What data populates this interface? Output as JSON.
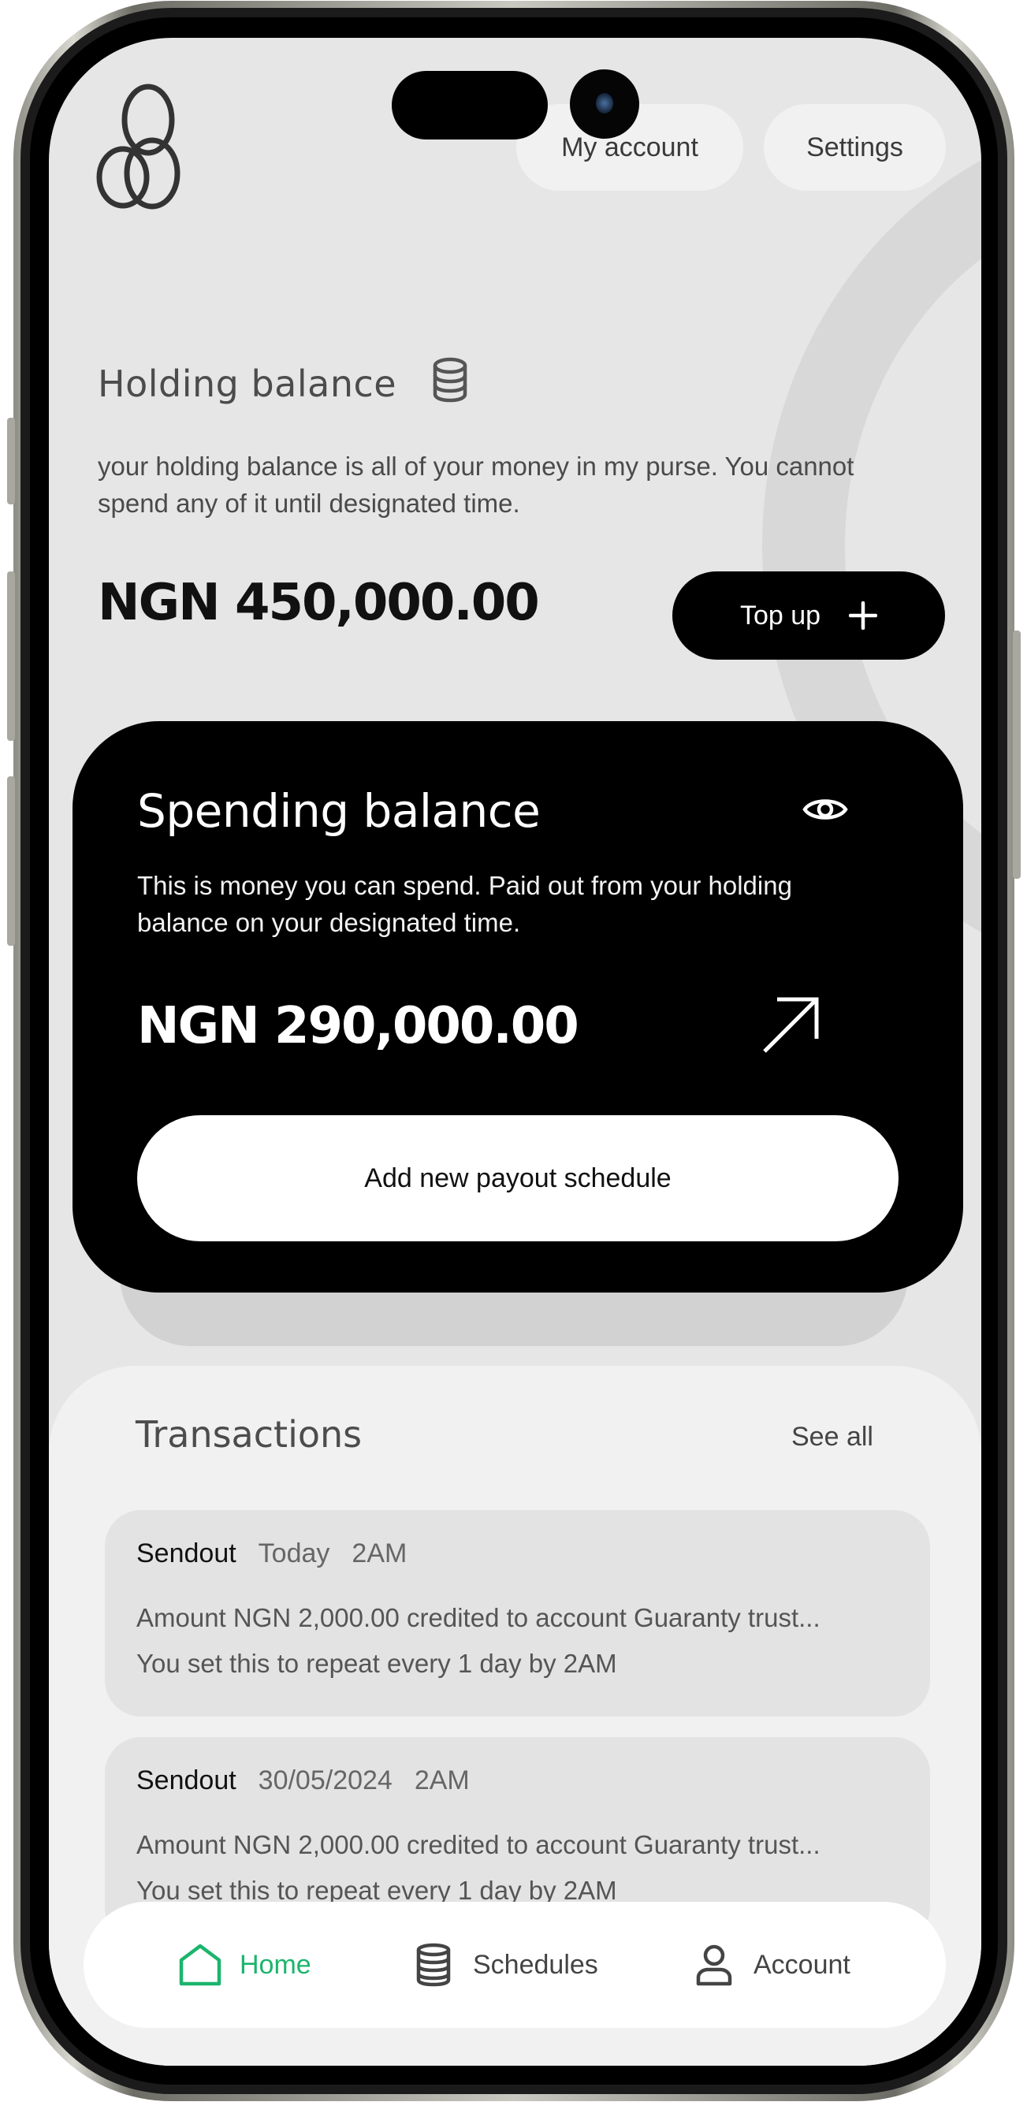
{
  "header": {
    "my_account_label": "My account",
    "settings_label": "Settings"
  },
  "holding": {
    "title": "Holding balance",
    "description": "your holding balance is all of your money in my purse. You cannot spend any of it until designated time.",
    "amount": "NGN 450,000.00",
    "topup_label": "Top up"
  },
  "spending": {
    "title": "Spending balance",
    "description": "This is money you can spend. Paid out from your holding balance on your designated time.",
    "amount": "NGN 290,000.00",
    "payout_button_label": "Add new payout schedule"
  },
  "transactions": {
    "title": "Transactions",
    "see_all_label": "See all",
    "items": [
      {
        "type": "Sendout",
        "date": "Today",
        "time": "2AM",
        "line1": "Amount NGN 2,000.00 credited to account Guaranty trust...",
        "line2": "You set this to repeat every 1 day by 2AM"
      },
      {
        "type": "Sendout",
        "date": "30/05/2024",
        "time": "2AM",
        "line1": "Amount NGN 2,000.00 credited to account Guaranty trust...",
        "line2": "You set this to repeat every 1 day by 2AM"
      }
    ]
  },
  "nav": {
    "items": [
      {
        "label": "Home",
        "icon": "home-icon",
        "active": true
      },
      {
        "label": "Schedules",
        "icon": "coins-icon",
        "active": false
      },
      {
        "label": "Account",
        "icon": "user-icon",
        "active": false
      }
    ]
  },
  "colors": {
    "accent_green": "#1bb56c",
    "screen_bg": "#e6e6e6",
    "card_black": "#000000"
  }
}
